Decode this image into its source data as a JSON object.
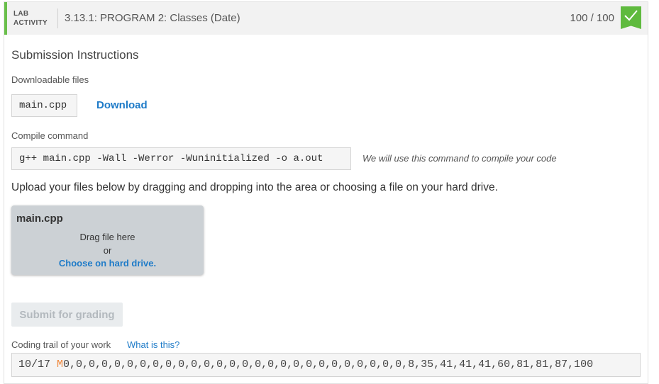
{
  "header": {
    "lab_label_line1": "LAB",
    "lab_label_line2": "ACTIVITY",
    "title": "3.13.1: PROGRAM 2: Classes (Date)",
    "score": "100 / 100",
    "badge_icon": "check-icon",
    "accent_color": "#6abf4b"
  },
  "submission": {
    "section_title": "Submission Instructions",
    "downloadable_label": "Downloadable files",
    "file_name": "main.cpp",
    "download_link": "Download",
    "compile_label": "Compile command",
    "compile_command": "g++ main.cpp -Wall -Werror -Wuninitialized -o a.out",
    "compile_hint": "We will use this command to compile your code",
    "upload_instructions": "Upload your files below by dragging and dropping into the area or choosing a file on your hard drive."
  },
  "dropzone": {
    "file_name": "main.cpp",
    "drag_text": "Drag file here",
    "or_text": "or",
    "choose_link": "Choose on hard drive."
  },
  "submit_button": "Submit for grading",
  "trail": {
    "label": "Coding trail of your work",
    "help_link": "What is this?",
    "date": "10/17",
    "marker": "M",
    "values": "0,0,0,0,0,0,0,0,0,0,0,0,0,0,0,0,0,0,0,0,0,0,0,0,0,0,0,8,35,41,41,41,60,81,81,87,100"
  },
  "colors": {
    "link": "#1e7bc8",
    "badge": "#5fba3e",
    "trail_marker": "#f0873a"
  }
}
